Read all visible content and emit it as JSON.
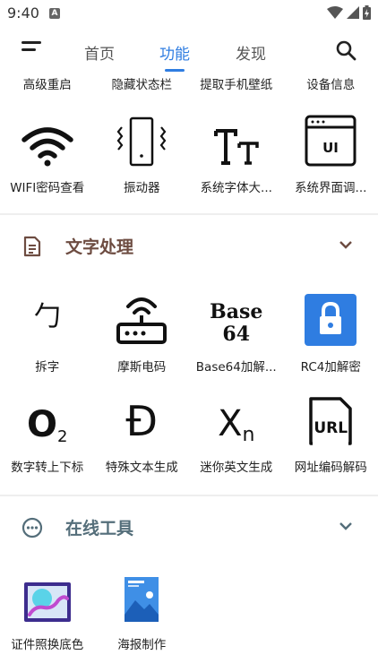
{
  "status": {
    "time": "9:40",
    "notif": "A"
  },
  "tabs": [
    {
      "label": "首页"
    },
    {
      "label": "功能"
    },
    {
      "label": "发现"
    }
  ],
  "top_row": [
    {
      "label": "高级重启"
    },
    {
      "label": "隐藏状态栏"
    },
    {
      "label": "提取手机壁纸"
    },
    {
      "label": "设备信息"
    }
  ],
  "row1": [
    {
      "label": "WIFI密码查看",
      "icon": "wifi-icon"
    },
    {
      "label": "振动器",
      "icon": "vibration-icon"
    },
    {
      "label": "系统字体大...",
      "icon": "text-size-icon"
    },
    {
      "label": "系统界面调...",
      "icon": "ui-window-icon"
    }
  ],
  "section_text": {
    "title": "文字处理",
    "color": "#6d4c41"
  },
  "row2": [
    {
      "label": "拆字",
      "icon": "chinese-char-icon",
      "glyph": "勹"
    },
    {
      "label": "摩斯电码",
      "icon": "router-icon"
    },
    {
      "label": "Base64加解...",
      "icon": "base64-icon",
      "t1": "Base",
      "t2": "64"
    },
    {
      "label": "RC4加解密",
      "icon": "lock-icon",
      "color": "#2f7de1"
    }
  ],
  "row3": [
    {
      "label": "数字转上下标",
      "icon": "subscript-icon",
      "t1": "O",
      "t2": "2"
    },
    {
      "label": "特殊文本生成",
      "icon": "special-d-icon",
      "t1": "Đ"
    },
    {
      "label": "迷你英文生成",
      "icon": "mini-x-icon",
      "t1": "X",
      "t2": "n"
    },
    {
      "label": "网址编码解码",
      "icon": "url-file-icon",
      "t1": "URL"
    }
  ],
  "section_online": {
    "title": "在线工具",
    "color": "#546e7a"
  },
  "row4": [
    {
      "label": "证件照换底色",
      "icon": "photo-bg-icon"
    },
    {
      "label": "海报制作",
      "icon": "poster-icon"
    }
  ]
}
